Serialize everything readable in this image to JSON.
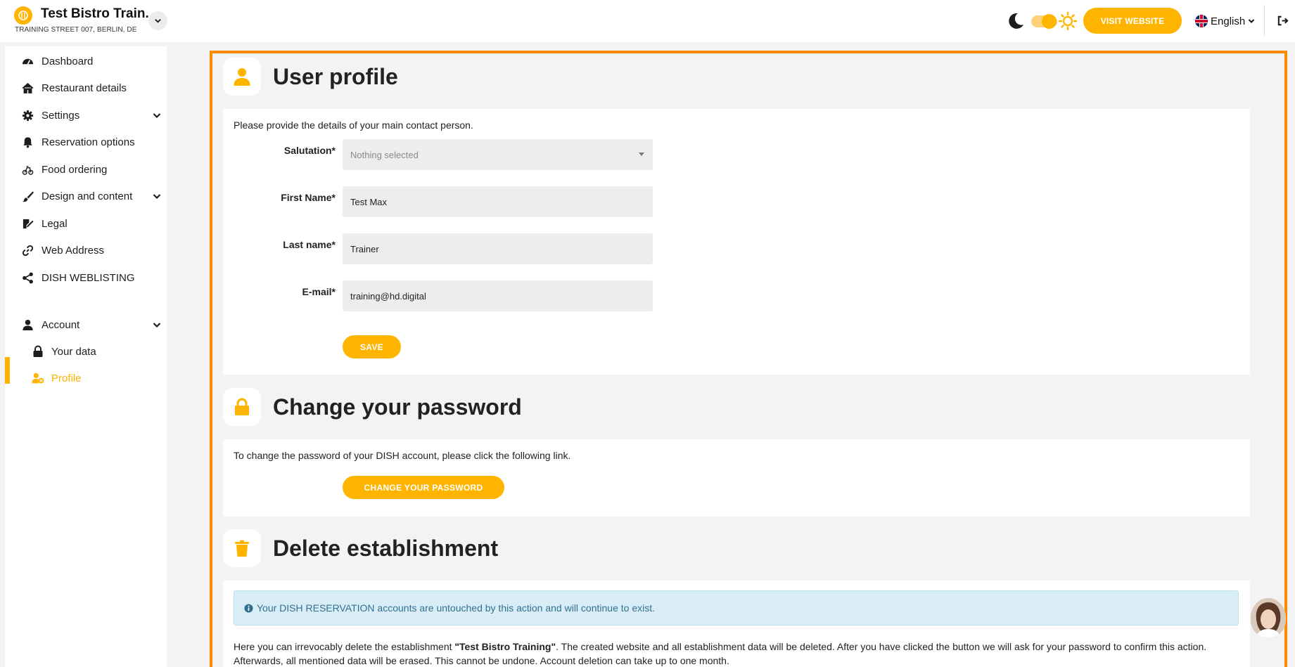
{
  "header": {
    "brand_name": "Test Bistro Train..",
    "brand_address": "TRAINING STREET 007, BERLIN, DE",
    "visit_website": "VISIT WEBSITE",
    "language": "English",
    "theme_toggle": "dark-light-toggle"
  },
  "sidebar": {
    "items": [
      {
        "label": "Dashboard",
        "icon": "dashboard-icon"
      },
      {
        "label": "Restaurant details",
        "icon": "home-icon"
      },
      {
        "label": "Settings",
        "icon": "gear-icon"
      },
      {
        "label": "Reservation options",
        "icon": "bell-icon"
      },
      {
        "label": "Food ordering",
        "icon": "food-ordering-icon"
      },
      {
        "label": "Design and content",
        "icon": "brush-icon"
      },
      {
        "label": "Legal",
        "icon": "legal-icon"
      },
      {
        "label": "Web Address",
        "icon": "link-icon"
      },
      {
        "label": "DISH WEBLISTING",
        "icon": "share-icon"
      },
      {
        "label": "Account",
        "icon": "user-icon"
      }
    ],
    "sub_items": [
      {
        "label": "Your data",
        "icon": "lock-icon"
      },
      {
        "label": "Profile",
        "icon": "user-cog-icon"
      }
    ]
  },
  "profile": {
    "title": "User profile",
    "intro": "Please provide the details of your main contact person.",
    "salutation_label": "Salutation*",
    "salutation_value": "Nothing selected",
    "first_name_label": "First Name*",
    "first_name_value": "Test Max",
    "last_name_label": "Last name*",
    "last_name_value": "Trainer",
    "email_label": "E-mail*",
    "email_value": "training@hd.digital",
    "save": "SAVE"
  },
  "password": {
    "title": "Change your password",
    "intro": "To change the password of your DISH account, please click the following link.",
    "button": "CHANGE YOUR PASSWORD"
  },
  "delete": {
    "title": "Delete establishment",
    "info": "Your DISH RESERVATION accounts are untouched by this action and will continue to exist.",
    "text_before": "Here you can irrevocably delete the establishment ",
    "establishment_name": "\"Test Bistro Training\"",
    "text_after": ". The created website and all establishment data will be deleted. After you have clicked the button we will ask for your password to confirm this action. Afterwards, all mentioned data will be erased. This cannot be undone. Account deletion can take up to one month."
  },
  "colors": {
    "accent": "#ffb400",
    "highlight_border": "#ff8a00",
    "info_bg": "#d9edf7",
    "info_text": "#31708f"
  }
}
